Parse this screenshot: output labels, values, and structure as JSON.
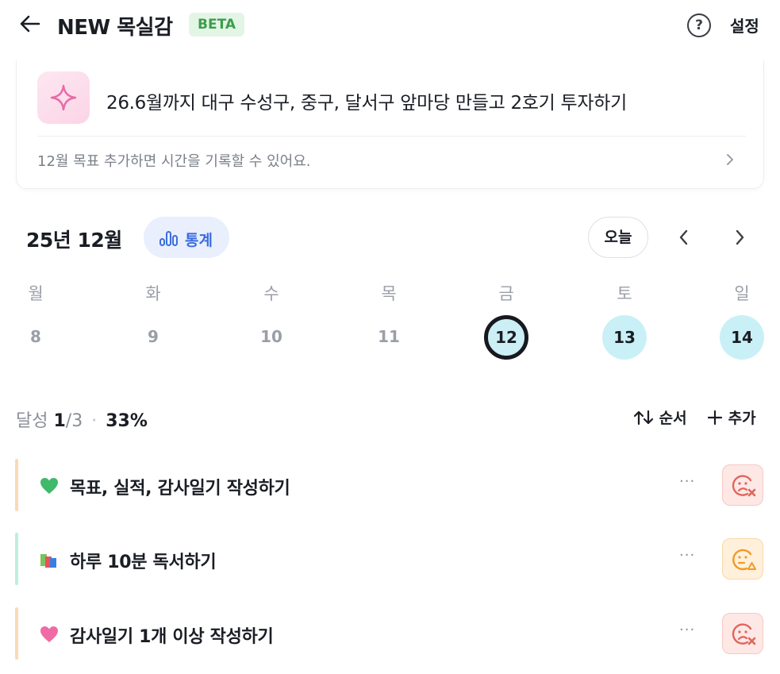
{
  "header": {
    "title": "NEW 목실감",
    "badge": "BETA",
    "help_icon": "question-circle-icon",
    "settings_label": "설정"
  },
  "goal": {
    "icon": "sparkle-icon",
    "title": "26.6월까지 대구 수성구, 중구, 달서구 앞마당 만들고 2호기 투자하기",
    "subtitle": "12월 목표  추가하면 시간을 기록할 수 있어요."
  },
  "calendar": {
    "month_label": "25년 12월",
    "stats_label": "통계",
    "today_label": "오늘",
    "weekdays": [
      "월",
      "화",
      "수",
      "목",
      "금",
      "토",
      "일"
    ],
    "days": [
      "8",
      "9",
      "10",
      "11",
      "12",
      "13",
      "14"
    ],
    "selected_day": "12",
    "colors": {
      "selected_fill": "#cbeff5",
      "future_fill": "#c9f0f6",
      "accent": "#3b6de0"
    }
  },
  "progress": {
    "label": "달성",
    "done": "1",
    "total": "/3",
    "separator": "·",
    "percent": "33%"
  },
  "toolbar": {
    "order_label": "순서",
    "add_label": "추가"
  },
  "tasks": [
    {
      "emoji": "green-heart-icon",
      "label": "목표, 실적, 감사일기 작성하기",
      "more": "···",
      "status": "fail",
      "bar_color": "#fbd9b6"
    },
    {
      "emoji": "books-icon",
      "label": "하루 10분 독서하기",
      "more": "···",
      "status": "warn",
      "bar_color": "#bfeedd"
    },
    {
      "emoji": "pink-heart-icon",
      "label": "감사일기 1개 이상 작성하기",
      "more": "···",
      "status": "fail",
      "bar_color": "#fbd9b6"
    }
  ]
}
